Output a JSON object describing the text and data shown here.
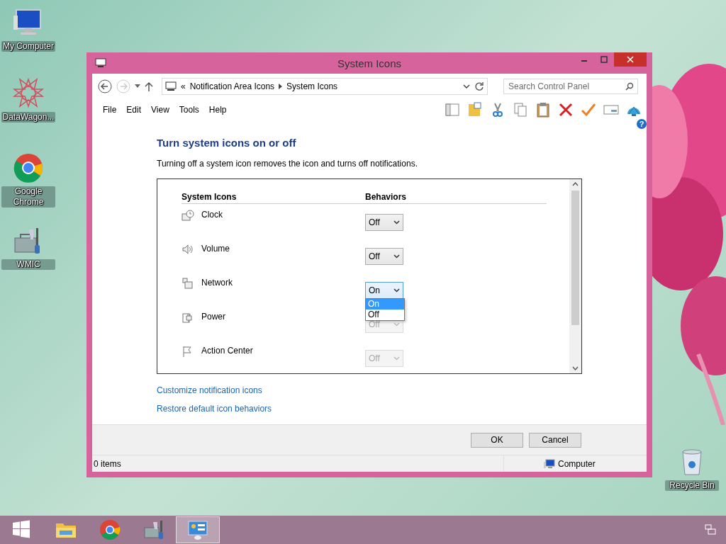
{
  "desktop_icons": [
    {
      "label": "My Computer",
      "kind": "computer"
    },
    {
      "label": "DataWagon...",
      "kind": "star"
    },
    {
      "label": "Google Chrome",
      "kind": "chrome"
    },
    {
      "label": "WMIC",
      "kind": "tools"
    },
    {
      "label": "Recycle Bin",
      "kind": "bin"
    }
  ],
  "window": {
    "title": "System Icons"
  },
  "address": {
    "prefix": "«",
    "breadcrumb": [
      "Notification Area Icons",
      "System Icons"
    ]
  },
  "search": {
    "placeholder": "Search Control Panel"
  },
  "menu": [
    "File",
    "Edit",
    "View",
    "Tools",
    "Help"
  ],
  "help": "?",
  "heading": "Turn system icons on or off",
  "description": "Turning off a system icon removes the icon and turns off notifications.",
  "table": {
    "columns": [
      "System Icons",
      "Behaviors"
    ],
    "rows": [
      {
        "name": "Clock",
        "kind": "clock",
        "value": "Off",
        "disabled": false,
        "expanded": false
      },
      {
        "name": "Volume",
        "kind": "volume",
        "value": "Off",
        "disabled": false,
        "expanded": false
      },
      {
        "name": "Network",
        "kind": "network",
        "value": "On",
        "disabled": false,
        "expanded": true,
        "options": [
          {
            "label": "On",
            "selected": true
          },
          {
            "label": "Off",
            "selected": false
          }
        ]
      },
      {
        "name": "Power",
        "kind": "power",
        "value": "Off",
        "disabled": true,
        "expanded": false
      },
      {
        "name": "Action Center",
        "kind": "flag",
        "value": "Off",
        "disabled": true,
        "expanded": false
      }
    ]
  },
  "links": [
    "Customize notification icons",
    "Restore default icon behaviors"
  ],
  "buttons": [
    "OK",
    "Cancel"
  ],
  "status_bar": {
    "items": "0 items",
    "location": "Computer"
  },
  "taskbar": [
    {
      "kind": "start",
      "selected": false
    },
    {
      "kind": "explorer",
      "selected": false
    },
    {
      "kind": "chrome",
      "selected": false
    },
    {
      "kind": "tools",
      "selected": false
    },
    {
      "kind": "control-panel",
      "selected": true
    }
  ]
}
